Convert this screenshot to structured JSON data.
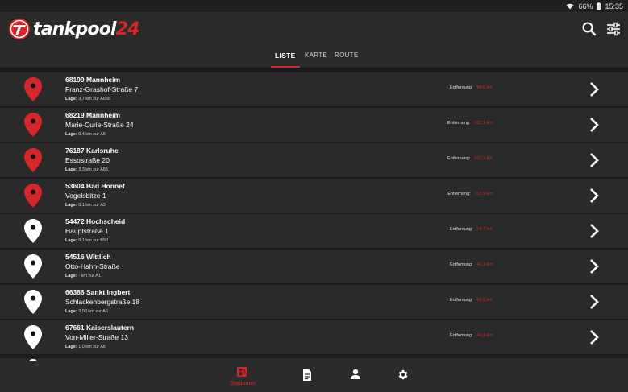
{
  "statusbar": {
    "battery": "66%",
    "time": "15:35"
  },
  "brand": {
    "name_main": "tankpool",
    "name_number": "24",
    "accent": "#d7262b"
  },
  "appbar": {
    "search_icon": "search-icon",
    "filter_icon": "sliders-icon"
  },
  "tabs": [
    {
      "label": "LISTE",
      "active": true
    },
    {
      "label": "KARTE",
      "active": false
    },
    {
      "label": "ROUTE",
      "active": false
    }
  ],
  "stations": [
    {
      "city": "68199 Mannheim",
      "street": "Franz-Grashof-Straße 7",
      "lage_label": "Lage:",
      "lage": "3,7 km zur  A656",
      "dist_label": "Entfernung:",
      "dist": "98,6 km",
      "pin": "red"
    },
    {
      "city": "68219 Mannheim",
      "street": "Marie-Curie-Straße 24",
      "lage_label": "Lage:",
      "lage": "0,4 km zur  A6",
      "dist_label": "Entfernung:",
      "dist": "102,1 km",
      "pin": "red"
    },
    {
      "city": "76187 Karlsruhe",
      "street": "Essostraße 20",
      "lage_label": "Lage:",
      "lage": "3,3 km zur  A65",
      "dist_label": "Entfernung:",
      "dist": "107,9 km",
      "pin": "red"
    },
    {
      "city": "53604 Bad Honnef",
      "street": "Vogelsbitze 1",
      "lage_label": "Lage:",
      "lage": "0,1 km zur  A3",
      "dist_label": "Entfernung:",
      "dist": "110,9 km",
      "pin": "red"
    },
    {
      "city": "54472 Hochscheid",
      "street": "Hauptstraße 1",
      "lage_label": "Lage:",
      "lage": "0,1 km zur  B50",
      "dist_label": "Entfernung:",
      "dist": "24,7 km",
      "pin": "white"
    },
    {
      "city": "54516 Wittlich",
      "street": "Otto-Hahn-Straße",
      "lage_label": "Lage:",
      "lage": "- km zur  A1",
      "dist_label": "Entfernung:",
      "dist": "41,3 km",
      "pin": "white"
    },
    {
      "city": "66386 Sankt Ingbert",
      "street": "Schlackenbergstraße 18",
      "lage_label": "Lage:",
      "lage": "3,00 km zur  A6",
      "dist_label": "Entfernung:",
      "dist": "42,6 km",
      "pin": "white"
    },
    {
      "city": "67661 Kaiserslautern",
      "street": "Von-Miller-Straße 13",
      "lage_label": "Lage:",
      "lage": "1,0 km zur  A6",
      "dist_label": "Entfernung:",
      "dist": "42,8 km",
      "pin": "white"
    }
  ],
  "bottomnav": {
    "stations_label": "Stationen",
    "items": [
      "fuel-pump-icon",
      "document-icon",
      "person-icon",
      "gear-icon"
    ]
  }
}
